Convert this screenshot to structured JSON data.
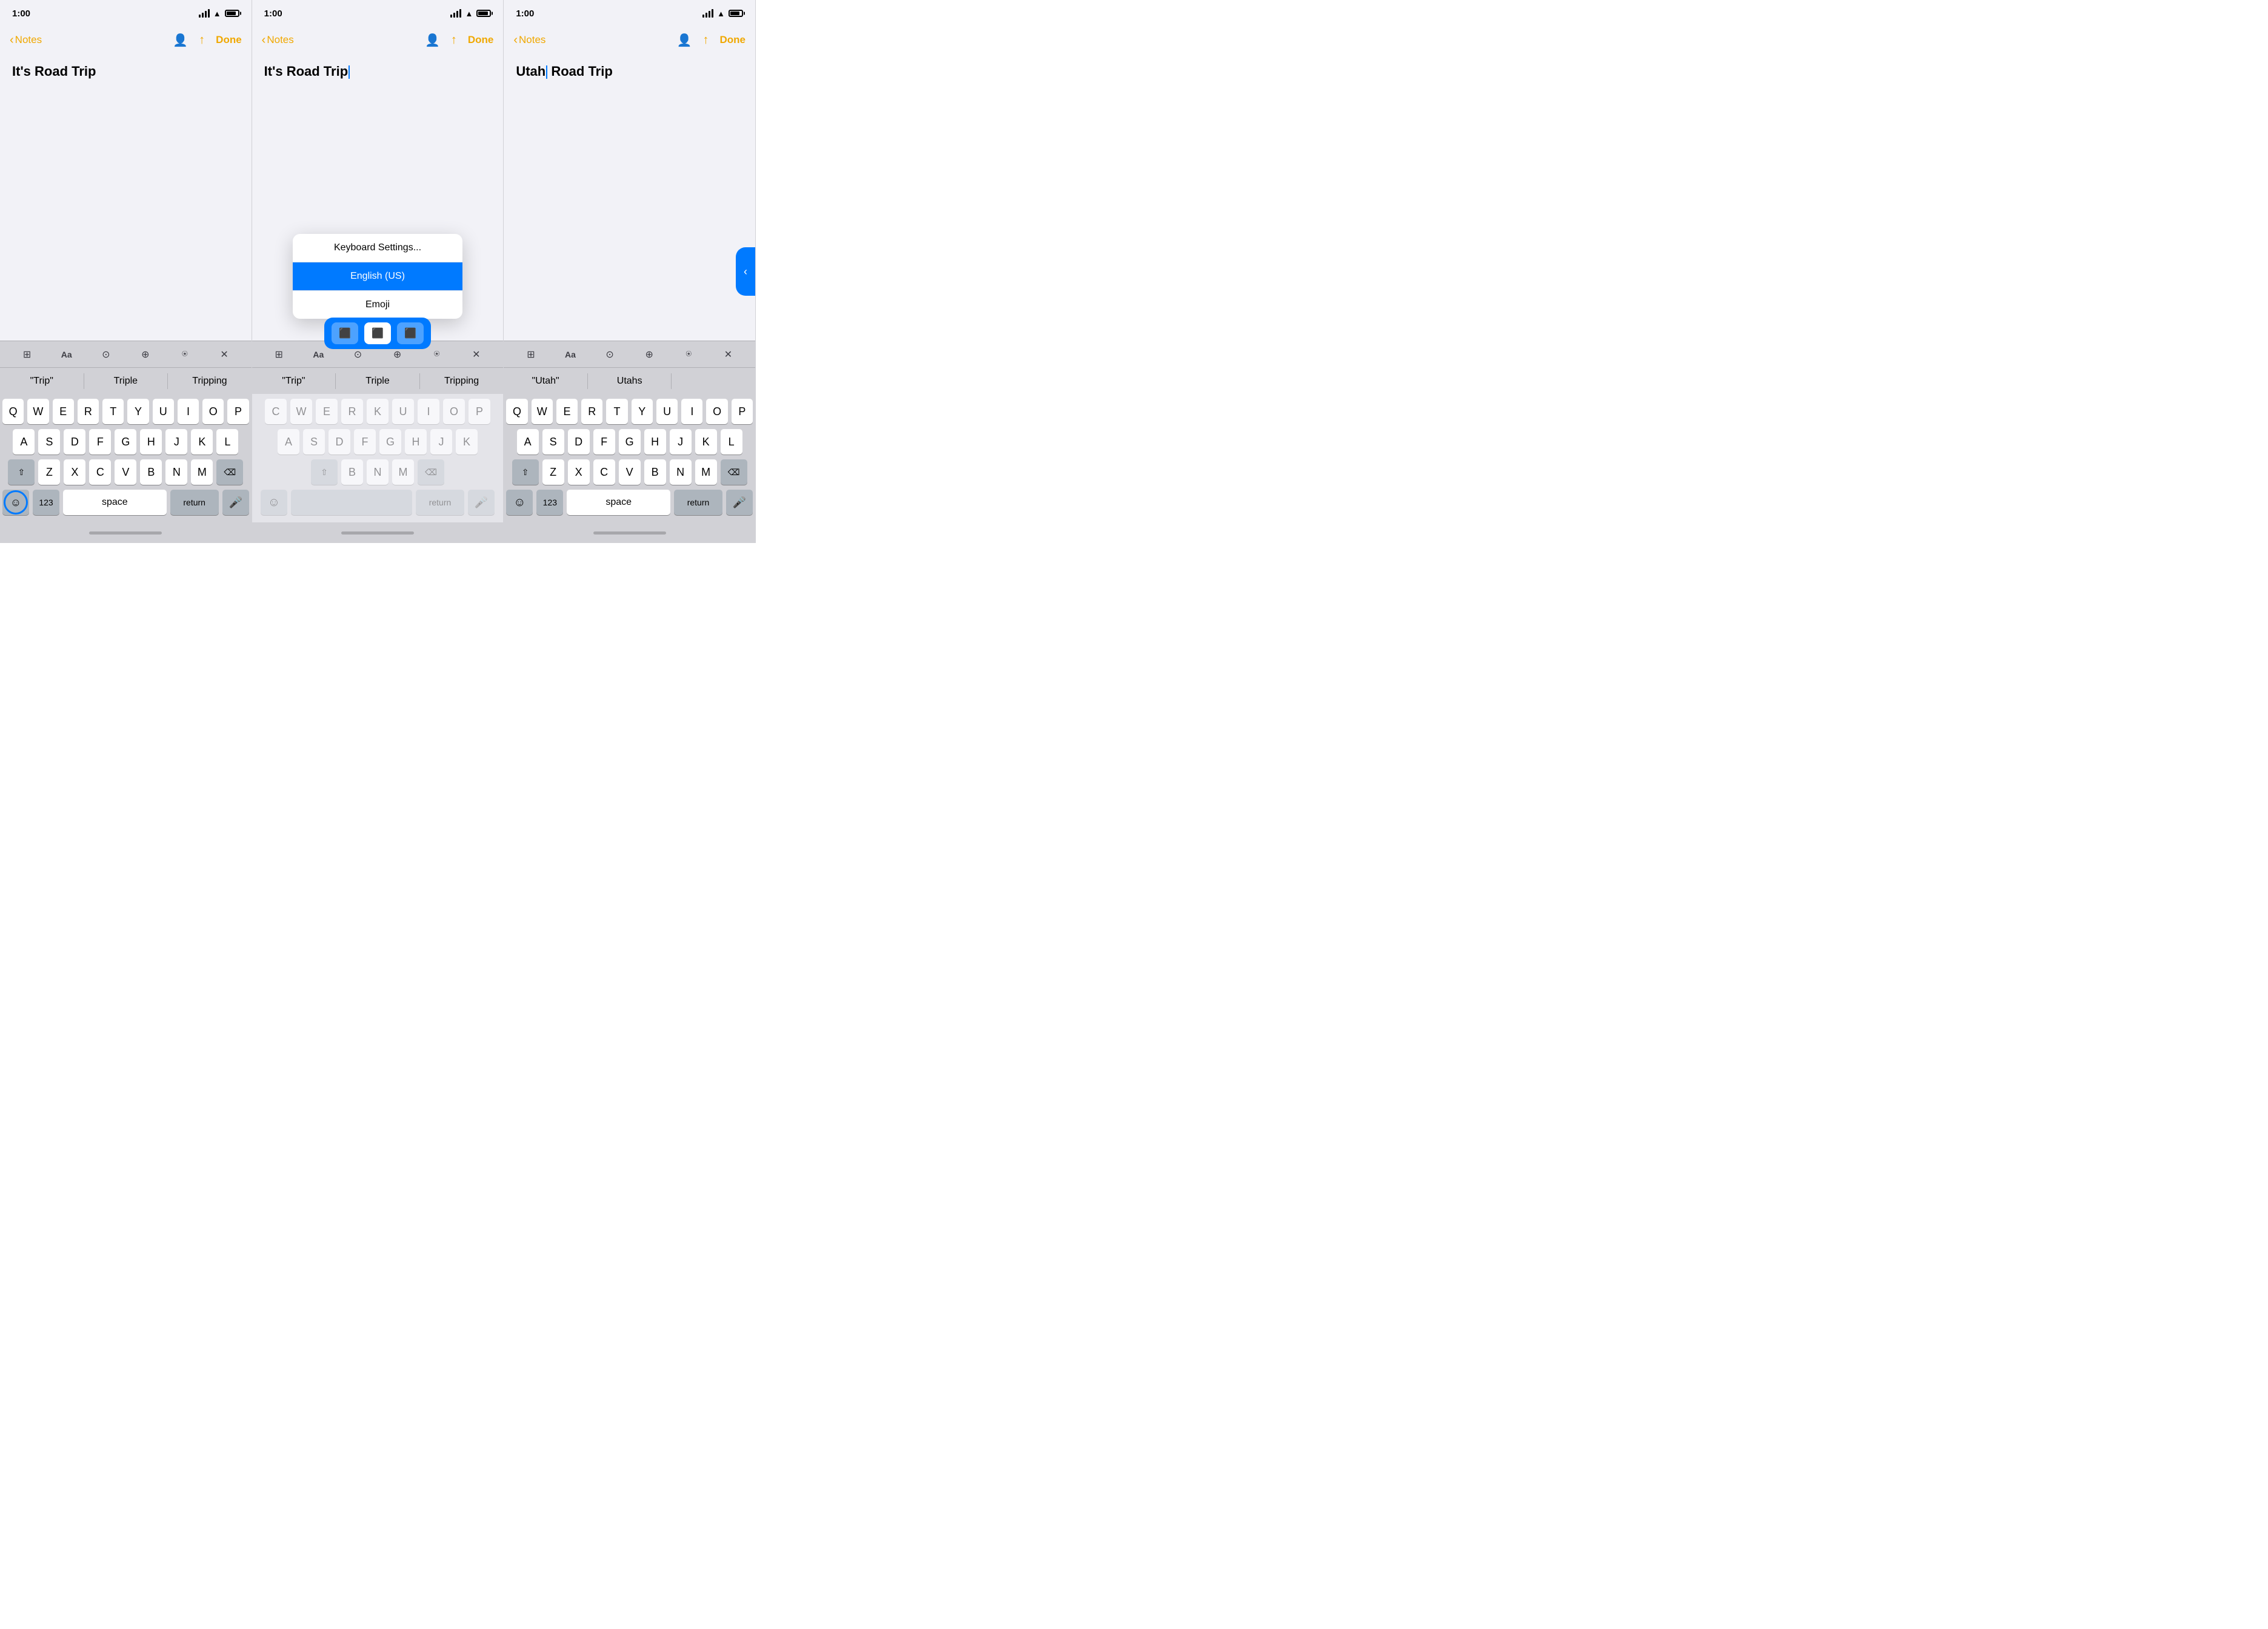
{
  "colors": {
    "accent": "#f0a800",
    "blue": "#007aff",
    "bg": "#f2f2f7",
    "keyboard_bg": "#d1d1d6",
    "key_bg": "#ffffff",
    "key_special_bg": "#adb5bd"
  },
  "panels": [
    {
      "id": "panel1",
      "status": {
        "time": "1:00",
        "signal": true,
        "wifi": true,
        "battery": true
      },
      "nav": {
        "back_label": "Notes",
        "done_label": "Done"
      },
      "note_title": "It's Road Trip",
      "suggestions": [
        "\"Trip\"",
        "Triple",
        "Tripping"
      ],
      "keyboard_rows": [
        [
          "Q",
          "W",
          "E",
          "R",
          "T",
          "Y",
          "U",
          "I",
          "O",
          "P"
        ],
        [
          "A",
          "S",
          "D",
          "F",
          "G",
          "H",
          "J",
          "K",
          "L"
        ],
        [
          "Z",
          "X",
          "C",
          "V",
          "B",
          "N",
          "M"
        ]
      ],
      "show_emoji_circle": true
    },
    {
      "id": "panel2",
      "status": {
        "time": "1:00",
        "signal": true,
        "wifi": true,
        "battery": true
      },
      "nav": {
        "back_label": "Notes",
        "done_label": "Done"
      },
      "note_title": "It's Road Trip",
      "cursor": true,
      "suggestions": [
        "\"Trip\"",
        "Triple",
        "Tripping"
      ],
      "popup": {
        "items": [
          {
            "label": "Keyboard Settings...",
            "active": false
          },
          {
            "label": "English (US)",
            "active": true
          },
          {
            "label": "Emoji",
            "active": false
          }
        ],
        "keyboard_options": [
          "⌨",
          "⌨",
          "⌨"
        ]
      },
      "show_emoji_circle": false
    },
    {
      "id": "panel3",
      "status": {
        "time": "1:00",
        "signal": true,
        "wifi": true,
        "battery": true
      },
      "nav": {
        "back_label": "Notes",
        "done_label": "Done"
      },
      "note_title": "Utah Road Trip",
      "cursor": true,
      "suggestions": [
        "\"Utah\"",
        "Utahs",
        ""
      ],
      "keyboard_rows": [
        [
          "Q",
          "W",
          "E",
          "R",
          "T",
          "Y",
          "U",
          "I",
          "O",
          "P"
        ],
        [
          "A",
          "S",
          "D",
          "F",
          "G",
          "H",
          "J",
          "K",
          "L"
        ],
        [
          "Z",
          "X",
          "C",
          "V",
          "B",
          "N",
          "M"
        ]
      ],
      "show_swipe_handle": true,
      "show_emoji_circle": false
    }
  ],
  "toolbar_icons": {
    "table": "⊞",
    "aa": "Aa",
    "check": "✓",
    "plus": "+",
    "pen": "✍",
    "close": "×"
  }
}
